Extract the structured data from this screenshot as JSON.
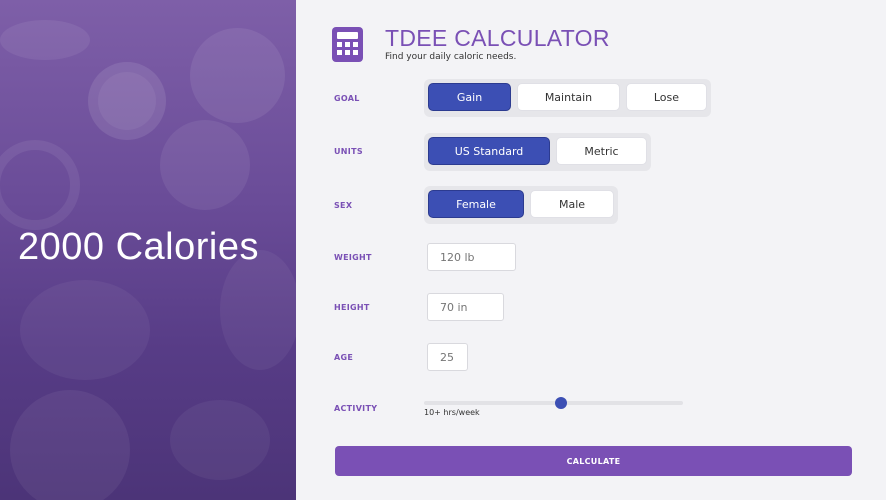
{
  "side_panel": {
    "calories_text": "2000 Calories"
  },
  "header": {
    "title": "TDEE CALCULATOR",
    "subtitle": "Find your daily caloric needs.",
    "logo_icon": "calculator-icon"
  },
  "colors": {
    "accent": "#7a50b5",
    "selected": "#3c4fb4",
    "background": "#f3f3f6"
  },
  "form": {
    "goal": {
      "label": "GOAL",
      "options": [
        "Gain",
        "Maintain",
        "Lose"
      ],
      "selected": "Gain"
    },
    "units": {
      "label": "UNITS",
      "options": [
        "US Standard",
        "Metric"
      ],
      "selected": "US Standard"
    },
    "sex": {
      "label": "SEX",
      "options": [
        "Female",
        "Male"
      ],
      "selected": "Female"
    },
    "weight": {
      "label": "WEIGHT",
      "placeholder": "120 lb"
    },
    "height": {
      "label": "HEIGHT",
      "placeholder": "70 in"
    },
    "age": {
      "label": "AGE",
      "placeholder": "25"
    },
    "activity": {
      "label": "ACTIVITY",
      "value_fraction": 0.53,
      "value_text": "10+ hrs/week"
    }
  },
  "calculate_button": {
    "label": "CALCULATE"
  }
}
